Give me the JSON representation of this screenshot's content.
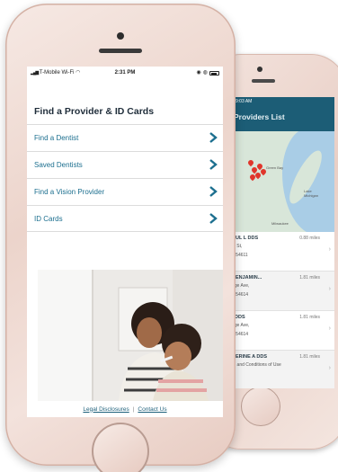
{
  "front_screen": {
    "status": {
      "carrier": "T-Mobile Wi-Fi",
      "time": "2:31 PM"
    },
    "page_title": "Find a Provider & ID Cards",
    "menu_items": [
      {
        "label": "Find a Dentist"
      },
      {
        "label": "Saved Dentists"
      },
      {
        "label": "Find a Vision Provider"
      },
      {
        "label": "ID Cards"
      }
    ],
    "footer": {
      "legal_label": "Legal Disclosures",
      "separator": "|",
      "contact_label": "Contact Us"
    }
  },
  "back_screen": {
    "status_time": "9:03 AM",
    "title": "Providers List",
    "map_labels": [
      "Green Bay",
      "Lake Michigan",
      "Milwaukee"
    ],
    "providers": [
      {
        "name": "AUL L DDS",
        "miles": "0.88 miles",
        "addr1": "in St,",
        "addr2": "I, 54611"
      },
      {
        "name": "BENJAMIN...",
        "miles": "1.81 miles",
        "addr1": "age Ave,",
        "addr2": "I, 54614"
      },
      {
        "name": "I DDS",
        "miles": "1.81 miles",
        "addr1": "age Ave,",
        "addr2": "I, 54614"
      },
      {
        "name": "HERINE A DDS",
        "miles": "1.81 miles",
        "addr1": "rs and Conditions of Use",
        "addr2": ""
      }
    ]
  },
  "colors": {
    "accent": "#1c6f8f",
    "header_bar": "#1c5d76",
    "title_text": "#1f2d3a"
  }
}
